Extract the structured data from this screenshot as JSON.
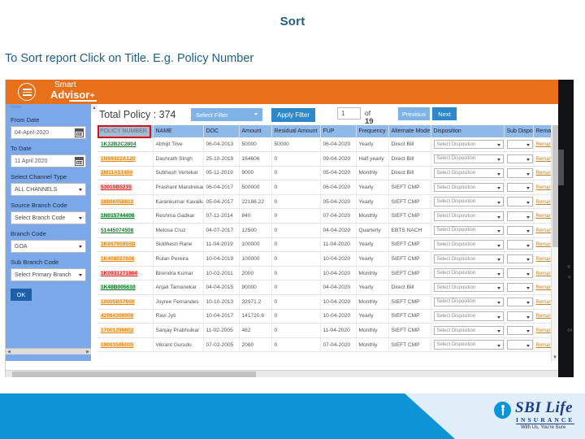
{
  "slide": {
    "title": "Sort",
    "instruction": "To Sort report Click on Title. E.g. Policy Number"
  },
  "app": {
    "logo_line1": "Smart",
    "logo_line2": "Advisor",
    "logo_plus": "+",
    "menu_icon": "hamburger-icon"
  },
  "sidebar": {
    "breadcrumb": "Home",
    "from_date": {
      "label": "From Date",
      "value": "04-April-2020"
    },
    "to_date": {
      "label": "To Date",
      "value": "11 April 2020"
    },
    "channel_type": {
      "label": "Select Channel Type",
      "value": "ALL CHANNELS"
    },
    "source_branch": {
      "label": "Source Branch Code",
      "value": "Select Branch Code"
    },
    "branch_code": {
      "label": "Branch Code",
      "value": "GOA"
    },
    "sub_branch": {
      "label": "Sub Branch Code",
      "value": "Select Primary Branch"
    },
    "ok_label": "OK"
  },
  "toolbar": {
    "total_policy": "Total Policy : 374",
    "select_filter": "Select Filter",
    "apply_filter": "Apply Filter",
    "page_value": "1",
    "page_of_prefix": "of",
    "page_total": "19",
    "previous": "Previous",
    "next": "Next"
  },
  "table": {
    "columns": [
      "POLICY NUMBER",
      "NAME",
      "DOC",
      "Amount",
      "Residual Amount",
      "FUP",
      "Frequency",
      "Alternate Mode",
      "Disposition",
      "Sub Disposition",
      "Remark"
    ],
    "disposition_placeholder": "Select Disposition",
    "remark_label": "Remark",
    "sorted_column": "POLICY NUMBER",
    "rows": [
      {
        "policy": "1K32B2C2804",
        "color": "green",
        "name": "Abhijit Tilve",
        "doc": "06-04-2013",
        "amount": "50000",
        "residual": "50000",
        "fup": "06-04-2020",
        "freq": "Yearly",
        "mode": "Direct Bill"
      },
      {
        "policy": "1N98422A120",
        "color": "orange",
        "name": "Dashrath Singh",
        "doc": "25-10-2019",
        "amount": "164606",
        "residual": "0",
        "fup": "09-04-2020",
        "freq": "Half yearly",
        "mode": "Direct Bill"
      },
      {
        "policy": "2M11A51404",
        "color": "orange",
        "name": "Subhash Vertekar",
        "doc": "05-11-2019",
        "amount": "9000",
        "residual": "0",
        "fup": "05-04-2020",
        "freq": "Monthly",
        "mode": "Direct Bill"
      },
      {
        "policy": "53010B5235",
        "color": "red",
        "name": "Prashant Mandrekar",
        "doc": "06-04-2017",
        "amount": "500000",
        "residual": "0",
        "fup": "06-04-2020",
        "freq": "Yearly",
        "mode": "SIEFT CMP"
      },
      {
        "policy": "38866558810",
        "color": "orange",
        "name": "Karankumar Kavalkar",
        "doc": "05-04-2017",
        "amount": "22186.22",
        "residual": "0",
        "fup": "05-04-2020",
        "freq": "Yearly",
        "mode": "SIEFT CMP"
      },
      {
        "policy": "1N015744406",
        "color": "greenbg",
        "name": "Reshma Gadkar",
        "doc": "07-11-2014",
        "amount": "840",
        "residual": "0",
        "fup": "07-04-2020",
        "freq": "Monthly",
        "mode": "SIEFT CMP"
      },
      {
        "policy": "51445074508",
        "color": "green",
        "name": "Melosa Cruz",
        "doc": "04-07-2017",
        "amount": "12500",
        "residual": "0",
        "fup": "04-04-2020",
        "freq": "Quarterly",
        "mode": "EBTS NACH"
      },
      {
        "policy": "1K66790055B",
        "color": "orange",
        "name": "Siddhesh Rane",
        "doc": "11-04-2019",
        "amount": "100000",
        "residual": "0",
        "fup": "11-04-2020",
        "freq": "Yearly",
        "mode": "SIEFT CMP"
      },
      {
        "policy": "1K408027606",
        "color": "orange",
        "name": "Rulan Pereira",
        "doc": "10-04-2019",
        "amount": "100000",
        "residual": "0",
        "fup": "10-04-2020",
        "freq": "Yearly",
        "mode": "SIEFT CMP"
      },
      {
        "policy": "1K0931271804",
        "color": "red",
        "name": "Birendra Kumar",
        "doc": "10-02-2011",
        "amount": "2000",
        "residual": "0",
        "fup": "10-04-2020",
        "freq": "Monthly",
        "mode": "SIEFT CMP"
      },
      {
        "policy": "1K48B005610",
        "color": "greenbg",
        "name": "Anjali Tamanekar",
        "doc": "04-04-2015",
        "amount": "90000",
        "residual": "0",
        "fup": "04-04-2020",
        "freq": "Yearly",
        "mode": "Direct Bill"
      },
      {
        "policy": "10005B57600",
        "color": "orange",
        "name": "Joyree Fernandes",
        "doc": "10-10-2013",
        "amount": "32971.2",
        "residual": "0",
        "fup": "10-04-2020",
        "freq": "Monthly",
        "mode": "SIEFT CMP"
      },
      {
        "policy": "42964309906",
        "color": "orange",
        "name": "Ravi Jyti",
        "doc": "10-04-2017",
        "amount": "141720.6",
        "residual": "0",
        "fup": "10-04-2020",
        "freq": "Yearly",
        "mode": "SIEFT CMP"
      },
      {
        "policy": "17001299802",
        "color": "orange",
        "name": "Sanjay Prabhulkar",
        "doc": "11-02-2005",
        "amount": "482",
        "residual": "0",
        "fup": "11-04-2020",
        "freq": "Monthly",
        "mode": "SIEFT CMP"
      },
      {
        "policy": "19003585005",
        "color": "orange",
        "name": "Vikrant Gurudo",
        "doc": "07-02-2005",
        "amount": "2060",
        "residual": "0",
        "fup": "07-04-2020",
        "freq": "Monthly",
        "mode": "SIEFT CMP"
      }
    ]
  },
  "footer": {
    "brand": "SBI Life",
    "subbrand": "INSURANCE",
    "tagline": "With Us, You're Sure"
  },
  "colors": {
    "header_orange": "#e8701a",
    "sidebar_blue": "#7aa8e8",
    "accent_blue": "#2e87c8",
    "footer_blue": "#0d93d6",
    "title_blue": "#1f5f86",
    "sort_highlight": "#d41414"
  }
}
